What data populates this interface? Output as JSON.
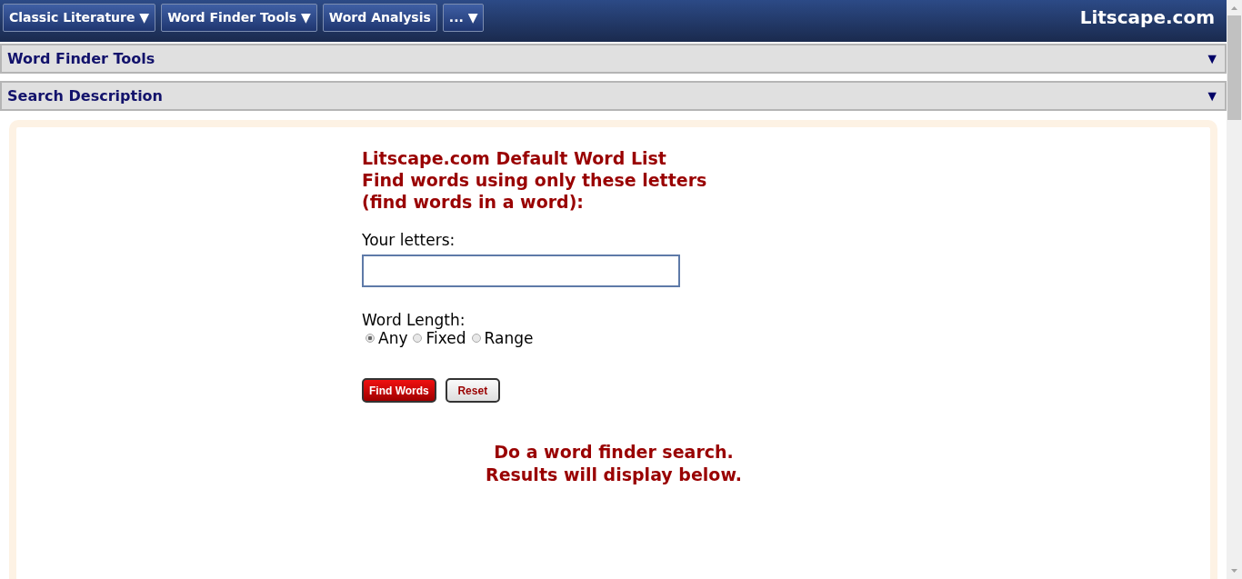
{
  "nav": {
    "menus": [
      {
        "label": "Classic Literature",
        "caret": "▼"
      },
      {
        "label": "Word Finder Tools",
        "caret": "▼"
      },
      {
        "label": "Word Analysis"
      },
      {
        "label": "...",
        "caret": "▼"
      }
    ],
    "site_title": "Litscape.com"
  },
  "panels": [
    {
      "title": "Word Finder Tools",
      "toggle": "▼"
    },
    {
      "title": "Search Description",
      "toggle": "▼"
    }
  ],
  "form": {
    "heading": [
      "Litscape.com Default Word List",
      "Find words using only these letters",
      "(find words in a word):"
    ],
    "letters_label": "Your letters:",
    "length_label": "Word Length:",
    "length_options": [
      {
        "label": "Any",
        "selected": true
      },
      {
        "label": "Fixed",
        "selected": false
      },
      {
        "label": "Range",
        "selected": false
      }
    ],
    "buttons": [
      {
        "label": "Find Words",
        "kind": "primary"
      },
      {
        "label": "Reset",
        "kind": "secondary"
      }
    ]
  },
  "message": [
    "Do a word finder search.",
    "Results will display below."
  ]
}
